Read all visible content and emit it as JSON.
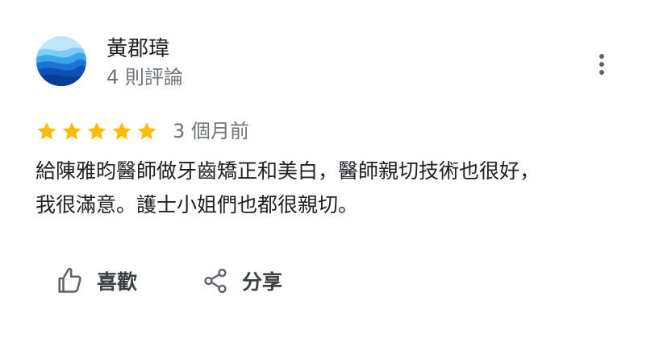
{
  "review": {
    "author": {
      "name": "黃郡瑋",
      "meta": "4 則評論"
    },
    "rating": 5,
    "date": "3 個月前",
    "text_lines": [
      "給陳雅昀醫師做牙齒矯正和美白，醫師親切技術也很好，",
      "我很滿意。護士小姐們也都很親切。"
    ],
    "actions": {
      "like_label": "喜歡",
      "share_label": "分享"
    }
  },
  "colors": {
    "star": "#fbbc04",
    "text_primary": "#202124",
    "text_secondary": "#70757a",
    "icon": "#5f6368"
  },
  "icons": {
    "menu": "more-vert-icon",
    "like": "thumb-up-icon",
    "share": "share-icon"
  }
}
